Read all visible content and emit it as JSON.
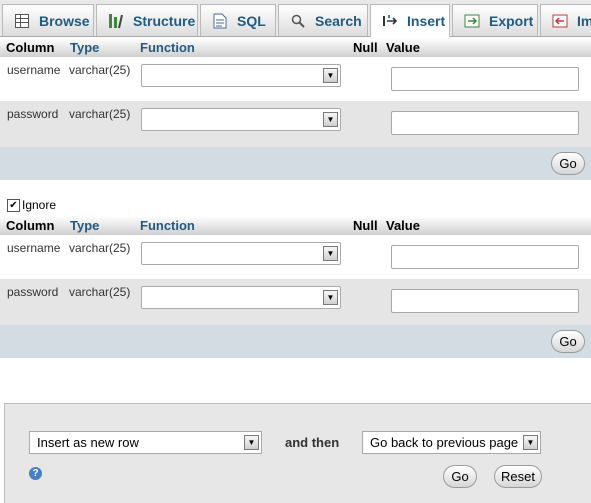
{
  "tabs": [
    {
      "label": "Browse",
      "icon": "browse-icon"
    },
    {
      "label": "Structure",
      "icon": "structure-icon"
    },
    {
      "label": "SQL",
      "icon": "sql-icon"
    },
    {
      "label": "Search",
      "icon": "search-icon"
    },
    {
      "label": "Insert",
      "icon": "insert-icon",
      "active": true
    },
    {
      "label": "Export",
      "icon": "export-icon"
    },
    {
      "label": "Im",
      "icon": "import-icon"
    }
  ],
  "columns_header": {
    "column": "Column",
    "type": "Type",
    "function": "Function",
    "null": "Null",
    "value": "Value"
  },
  "form1": {
    "rows": [
      {
        "column": "username",
        "type": "varchar(25)",
        "function": "",
        "value": ""
      },
      {
        "column": "password",
        "type": "varchar(25)",
        "function": "",
        "value": ""
      }
    ],
    "go_label": "Go"
  },
  "ignore": {
    "label": "Ignore",
    "checked": true
  },
  "form2": {
    "rows": [
      {
        "column": "username",
        "type": "varchar(25)",
        "function": "",
        "value": ""
      },
      {
        "column": "password",
        "type": "varchar(25)",
        "function": "",
        "value": ""
      }
    ],
    "go_label": "Go"
  },
  "bottom": {
    "insert_mode": "Insert as new row",
    "and_then": "and then",
    "after_action": "Go back to previous page",
    "go_label": "Go",
    "reset_label": "Reset"
  },
  "colors": {
    "header_text": "#235a81",
    "footer_bg": "#d4dce3",
    "panel_bg": "#e7e7e7",
    "alt_row_bg": "#e5e5e5"
  }
}
